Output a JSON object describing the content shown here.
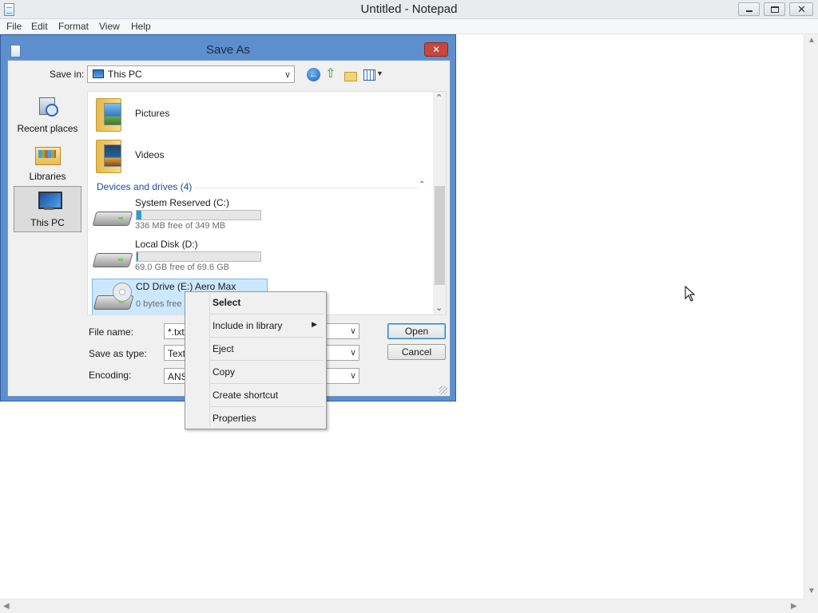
{
  "notepad": {
    "title": "Untitled - Notepad",
    "menu": [
      "File",
      "Edit",
      "Format",
      "View",
      "Help"
    ]
  },
  "dialog": {
    "title": "Save As",
    "close_label": "✕",
    "save_in_label": "Save in:",
    "save_in_value": "This PC",
    "places": [
      {
        "label": "Recent places",
        "icon": "recent-places-icon"
      },
      {
        "label": "Libraries",
        "icon": "libraries-icon"
      },
      {
        "label": "This PC",
        "icon": "this-pc-icon",
        "selected": true
      }
    ],
    "folders": [
      {
        "name": "Pictures",
        "icon": "pictures-folder-icon"
      },
      {
        "name": "Videos",
        "icon": "videos-folder-icon"
      }
    ],
    "group_header": "Devices and drives (4)",
    "drives": [
      {
        "name": "System Reserved (C:)",
        "free_text": "336 MB free of 349 MB",
        "used_fraction": 0.04,
        "icon": "hard-drive-icon"
      },
      {
        "name": "Local Disk (D:)",
        "free_text": "69.0 GB free of 69.6 GB",
        "used_fraction": 0.01,
        "icon": "hard-drive-icon"
      },
      {
        "name": "CD Drive (E:) Aero Max",
        "free_text": "0 bytes free",
        "icon": "cd-drive-icon",
        "selected": true
      }
    ],
    "file_name_label": "File name:",
    "file_name_value": "*.txt",
    "save_type_label": "Save as type:",
    "save_type_value": "Text",
    "encoding_label": "Encoding:",
    "encoding_value": "ANSI",
    "open_label": "Open",
    "cancel_label": "Cancel"
  },
  "context_menu": {
    "items": [
      {
        "label": "Select",
        "bold": true
      },
      {
        "label": "Include in library",
        "submenu": true
      },
      {
        "label": "Eject"
      },
      {
        "label": "Copy"
      },
      {
        "label": "Create shortcut"
      },
      {
        "label": "Properties"
      }
    ]
  },
  "colors": {
    "dialog_frame": "#5d8fcf",
    "selection": "#cce8ff",
    "drive_bar": "#26a0da",
    "group_header": "#1e4d9b"
  }
}
